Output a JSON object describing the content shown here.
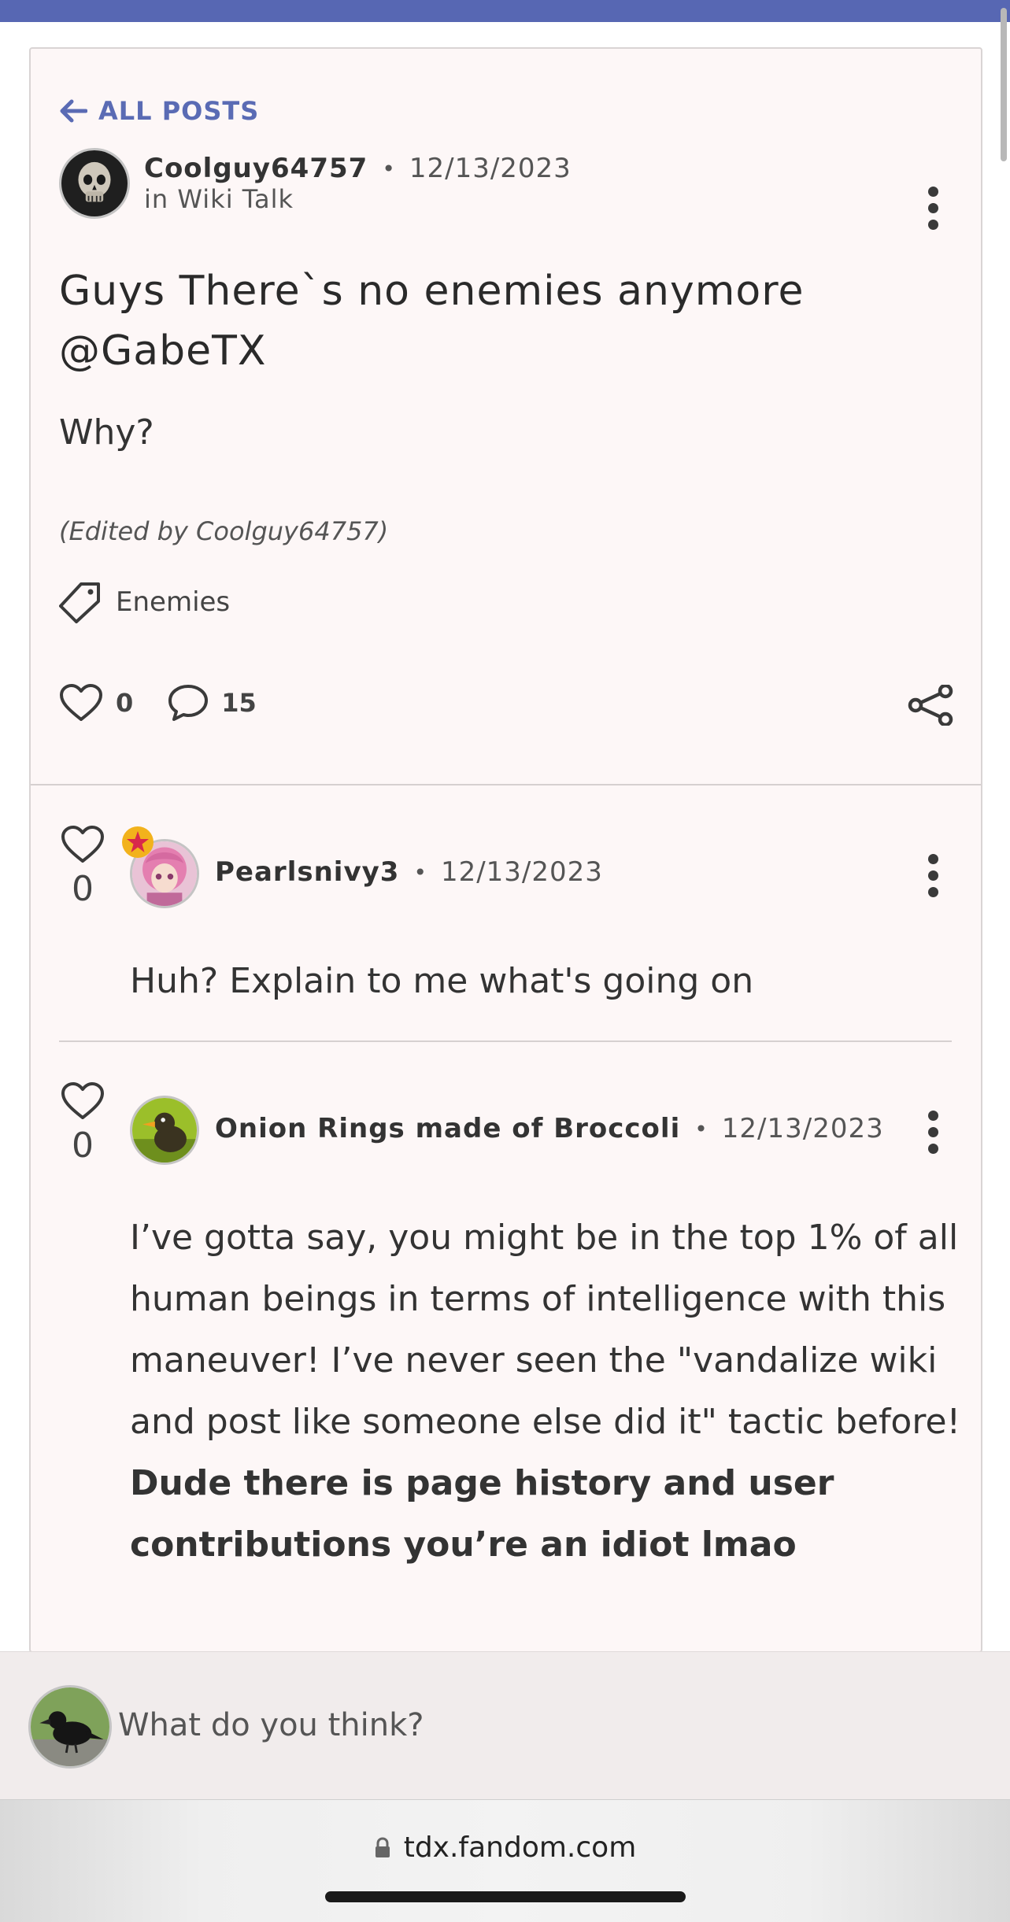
{
  "nav": {
    "back_label": "ALL POSTS"
  },
  "post": {
    "author": "Coolguy64757",
    "date": "12/13/2023",
    "category": "in Wiki Talk",
    "title": "Guys There`s no enemies anymore @GabeTX",
    "body": "Why?",
    "edited": "(Edited by Coolguy64757)",
    "tag": "Enemies",
    "likes": "0",
    "comments": "15"
  },
  "replies": [
    {
      "author": "Pearlsnivy3",
      "date": "12/13/2023",
      "likes": "0",
      "text": "Huh? Explain to me what's going on"
    },
    {
      "author": "Onion Rings made of Broccoli",
      "date": "12/13/2023",
      "likes": "0",
      "text": "I’ve gotta say, you might be in the top 1% of all human beings in terms of intelligence with this maneuver! I’ve never seen the \"vandalize wiki and post like someone else did it\" tactic before!",
      "bold_text": "Dude there is page history and user contributions you’re an idiot lmao"
    }
  ],
  "comment_box": {
    "placeholder": "What do you think?"
  },
  "browser": {
    "url": "tdx.fandom.com"
  },
  "colors": {
    "accent": "#5767b3",
    "link": "#5a6bb4",
    "card_bg": "#fdf7f7",
    "comment_bar_bg": "#f1ecec"
  },
  "icons": [
    "arrow-left-icon",
    "kebab-menu-icon",
    "tag-icon",
    "heart-icon",
    "comment-icon",
    "share-icon",
    "lock-icon",
    "admin-star-badge-icon"
  ]
}
